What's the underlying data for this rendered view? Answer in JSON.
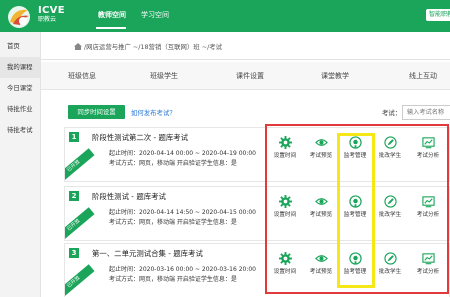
{
  "brand": {
    "name_en": "ICVE",
    "name_cn": "职教云"
  },
  "nav": [
    {
      "label": "教师空间",
      "active": true
    },
    {
      "label": "学习空间",
      "active": false
    }
  ],
  "top_right": {
    "smart_button": "智能职教"
  },
  "sidebar": {
    "items": [
      {
        "label": "首页",
        "active": false
      },
      {
        "label": "我的课程",
        "active": true
      },
      {
        "label": "今日课堂",
        "active": false
      },
      {
        "label": "待批作业",
        "active": false
      },
      {
        "label": "待批考试",
        "active": false
      }
    ]
  },
  "breadcrumb": {
    "text": "/网店运营与推广 ~/18营销（互联网）班 ~/考试"
  },
  "tabs": [
    "班级信息",
    "班级学生",
    "课件设置",
    "课堂教学",
    "线上互动"
  ],
  "toolbar": {
    "sync_label": "同步时间设置",
    "howto_label": "如何发布考试？",
    "exam_label": "考试：",
    "search_placeholder": "输入考试名称"
  },
  "exams": [
    {
      "num": "1",
      "title": "阶段性测试第二次 - 题库考试",
      "ribbon": "已开放",
      "time_label": "起止时间：",
      "time_value": "2020-04-14 00:00 ~ 2020-04-19 00:00",
      "form_label": "考试方式：",
      "form_value": "网页，移动端  开启验证学生信息：是"
    },
    {
      "num": "2",
      "title": "阶段性测试 - 题库考试",
      "ribbon": "已开放",
      "time_label": "起止时间：",
      "time_value": "2020-04-14 14:50 ~ 2020-04-15 00:00",
      "form_label": "考试方式：",
      "form_value": "网页，移动端  开启验证学生信息：是"
    },
    {
      "num": "3",
      "title": "第一、二单元测试合集 - 题库考试",
      "ribbon": "已开放",
      "time_label": "起止时间：",
      "time_value": "2020-03-16 00:00 ~ 2020-03-16 20:00",
      "form_label": "考试方式：",
      "form_value": "网页，移动端  开启验证学生信息：是"
    }
  ],
  "actions": [
    {
      "label": "设置时间",
      "icon": "gear-icon"
    },
    {
      "label": "考试预览",
      "icon": "eye-icon"
    },
    {
      "label": "监考管理",
      "icon": "monitor-icon"
    },
    {
      "label": "批改学生",
      "icon": "pen-icon"
    },
    {
      "label": "考试分析",
      "icon": "chart-icon"
    }
  ],
  "colors": {
    "primary": "#1aa55a",
    "highlight_red": "#e23a3a",
    "highlight_yellow": "#f6e816",
    "link": "#2d7bd6"
  }
}
